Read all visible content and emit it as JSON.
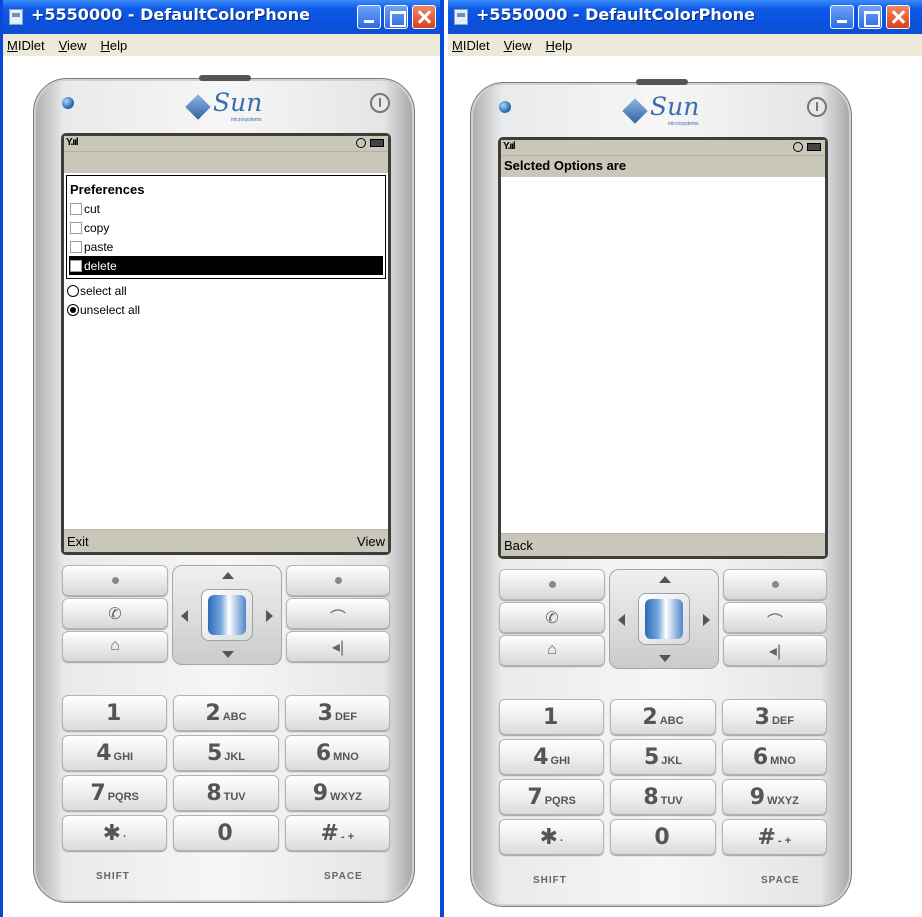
{
  "windows": [
    {
      "title": "+5550000 - DefaultColorPhone",
      "menu": [
        "MIDlet",
        "View",
        "Help"
      ],
      "screen": {
        "signal": "Y.ııl",
        "title_strip": "",
        "group": {
          "title": "Preferences",
          "items": [
            {
              "label": "cut",
              "checked": false,
              "selected": false
            },
            {
              "label": "copy",
              "checked": false,
              "selected": false
            },
            {
              "label": "paste",
              "checked": false,
              "selected": false
            },
            {
              "label": "delete",
              "checked": false,
              "selected": true
            }
          ]
        },
        "radios": [
          {
            "label": "select all",
            "on": false
          },
          {
            "label": "unselect all",
            "on": true
          }
        ],
        "soft_left": "Exit",
        "soft_right": "View"
      }
    },
    {
      "title": "+5550000 - DefaultColorPhone",
      "menu": [
        "MIDlet",
        "View",
        "Help"
      ],
      "screen": {
        "signal": "Y.ııl",
        "title_strip": "Selcted Options are",
        "soft_left": "Back",
        "soft_right": ""
      }
    }
  ],
  "phone": {
    "brand": "Sun",
    "brand_sub": "microsystems",
    "keys": [
      {
        "digit": "1",
        "letters": ""
      },
      {
        "digit": "2",
        "letters": "ABC"
      },
      {
        "digit": "3",
        "letters": "DEF"
      },
      {
        "digit": "4",
        "letters": "GHI"
      },
      {
        "digit": "5",
        "letters": "JKL"
      },
      {
        "digit": "6",
        "letters": "MNO"
      },
      {
        "digit": "7",
        "letters": "PQRS"
      },
      {
        "digit": "8",
        "letters": "TUV"
      },
      {
        "digit": "9",
        "letters": "WXYZ"
      },
      {
        "digit": "✱",
        "letters": "·"
      },
      {
        "digit": "0",
        "letters": ""
      },
      {
        "digit": "#",
        "letters": "- +"
      }
    ],
    "shift_label": "SHIFT",
    "space_label": "SPACE",
    "softkey_glyphs": {
      "call": "✆",
      "home": "⌂",
      "end": "⌒",
      "back": "◂|"
    }
  },
  "colors": {
    "titlebar": "#0a50dc",
    "screen_bar": "#c9c6ba",
    "nav_jewel": "#4f86cc"
  }
}
